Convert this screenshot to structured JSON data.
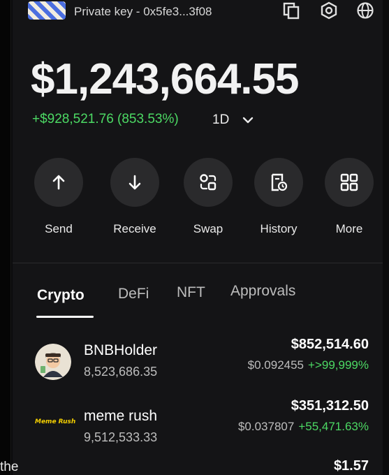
{
  "header": {
    "account_label": "Private key - 0x5fe3...3f08",
    "icons": [
      "copy-icon",
      "settings-hex-icon",
      "globe-icon"
    ]
  },
  "portfolio": {
    "balance": "$1,243,664.55",
    "change": "+$928,521.76 (853.53%)",
    "period": "1D"
  },
  "actions": [
    {
      "label": "Send",
      "icon": "arrow-up-icon"
    },
    {
      "label": "Receive",
      "icon": "arrow-down-icon"
    },
    {
      "label": "Swap",
      "icon": "swap-icon"
    },
    {
      "label": "History",
      "icon": "history-icon"
    },
    {
      "label": "More",
      "icon": "grid-icon"
    }
  ],
  "tabs": [
    {
      "label": "Crypto",
      "active": true
    },
    {
      "label": "DeFi",
      "active": false
    },
    {
      "label": "NFT",
      "active": false
    },
    {
      "label": "Approvals",
      "active": false
    }
  ],
  "tokens": [
    {
      "name": "BNBHolder",
      "amount": "8,523,686.35",
      "value": "$852,514.60",
      "price": "$0.092455",
      "change": "+>99,999%"
    },
    {
      "name": "meme rush",
      "amount": "9,512,533.33",
      "value": "$351,312.50",
      "price": "$0.037807",
      "change": "+55,471.63%",
      "logo_text": "Meme Rush"
    },
    {
      "value": "$1.57"
    }
  ],
  "edge_text": "the",
  "colors": {
    "positive": "#4cd964",
    "background": "#141416",
    "button": "#2a2a2c"
  }
}
